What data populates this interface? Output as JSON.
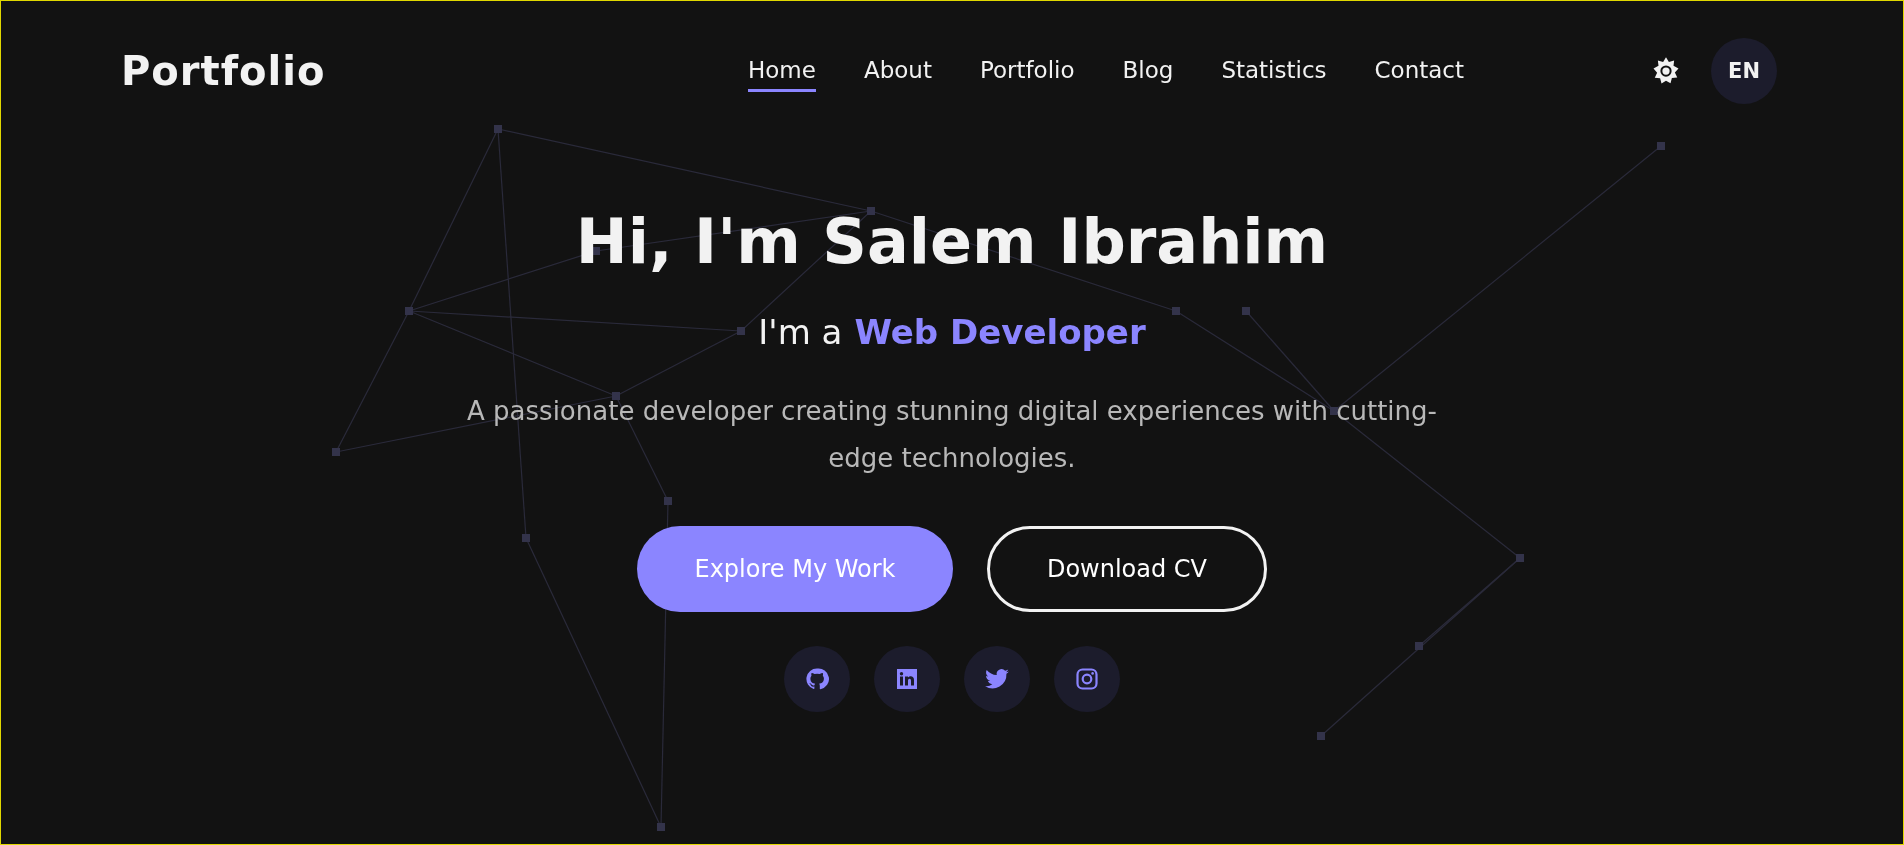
{
  "header": {
    "logo": "Portfolio",
    "nav": [
      {
        "label": "Home",
        "selected": true
      },
      {
        "label": "About",
        "selected": false
      },
      {
        "label": "Portfolio",
        "selected": false
      },
      {
        "label": "Blog",
        "selected": false
      },
      {
        "label": "Statistics",
        "selected": false
      },
      {
        "label": "Contact",
        "selected": false
      }
    ],
    "language": "EN"
  },
  "hero": {
    "title": "Hi, I'm Salem Ibrahim",
    "subtitle_prefix": "I'm a",
    "role": "Web Developer",
    "description": "A passionate developer creating stunning digital experiences with cutting-edge technologies.",
    "buttons": [
      {
        "label": "Explore My Work",
        "kind": "primary"
      },
      {
        "label": "Download CV",
        "kind": "outline"
      }
    ],
    "social": [
      {
        "kind": "github"
      },
      {
        "kind": "linkedin"
      },
      {
        "kind": "twitter"
      },
      {
        "kind": "instagram"
      }
    ]
  }
}
